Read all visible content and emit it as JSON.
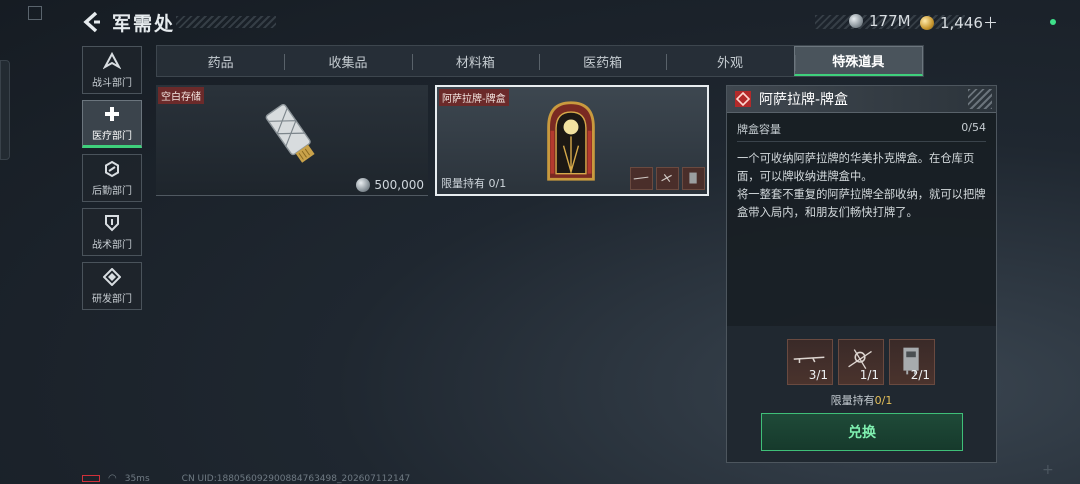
{
  "header": {
    "title": "军需处"
  },
  "currency": {
    "silver": "177M",
    "gold": "1,446＋"
  },
  "sidebar": {
    "items": [
      {
        "label": "战斗部门",
        "icon": "combat-icon"
      },
      {
        "label": "医疗部门",
        "icon": "medical-cross-icon",
        "active": true
      },
      {
        "label": "后勤部门",
        "icon": "logistics-icon"
      },
      {
        "label": "战术部门",
        "icon": "tactical-shield-icon"
      },
      {
        "label": "研发部门",
        "icon": "research-icon"
      }
    ]
  },
  "tabs": [
    {
      "label": "药品"
    },
    {
      "label": "收集品"
    },
    {
      "label": "材料箱"
    },
    {
      "label": "医药箱"
    },
    {
      "label": "外观"
    },
    {
      "label": "特殊道具",
      "active": true
    }
  ],
  "items": [
    {
      "tag": "空白存储",
      "price": "500,000",
      "icon": "usb-drive-icon"
    },
    {
      "tag": "阿萨拉牌-牌盒",
      "limit": "限量持有 0/1",
      "icon": "card-box-icon"
    }
  ],
  "detail": {
    "title": "阿萨拉牌-牌盒",
    "capacity_label": "牌盒容量",
    "capacity_value": "0/54",
    "desc1": "一个可收纳阿萨拉牌的华美扑克牌盒。在仓库页面，可以牌收纳进牌盒中。",
    "desc2": "将一整套不重复的阿萨拉牌全部收纳，就可以把牌盒带入局内，和朋友们畅快打牌了。",
    "rewards": [
      {
        "count": "3/1",
        "icon": "rifle-icon"
      },
      {
        "count": "1/1",
        "icon": "gear-parts-icon"
      },
      {
        "count": "2/1",
        "icon": "device-icon"
      }
    ],
    "limit_label": "限量持有",
    "limit_value": "0/1",
    "exchange_label": "兑换"
  },
  "footer": {
    "ping": "35ms",
    "uid": "CN UID:18805609290088476349​8_202607112147"
  },
  "colors": {
    "accent_green": "#3fd07c",
    "tag_red": "#6b2a2a",
    "limit_gold": "#e4c05a"
  }
}
